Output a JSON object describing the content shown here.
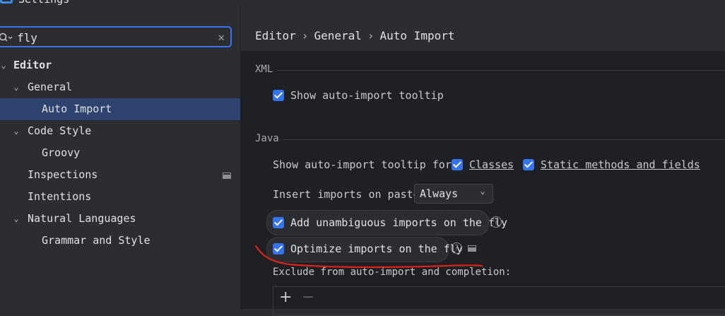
{
  "window": {
    "title": "Settings"
  },
  "search": {
    "value": "fly",
    "placeholder": ""
  },
  "tree": {
    "editor": "Editor",
    "general": "General",
    "auto_import": "Auto Import",
    "code_style": "Code Style",
    "groovy": "Groovy",
    "inspections": "Inspections",
    "intentions": "Intentions",
    "natural_languages": "Natural Languages",
    "grammar_and_style": "Grammar and Style"
  },
  "breadcrumb": [
    "Editor",
    "General",
    "Auto Import"
  ],
  "breadcrumb_sep": "›",
  "xml": {
    "section": "XML",
    "show_tooltip": "Show auto-import tooltip",
    "show_tooltip_checked": true
  },
  "java": {
    "section": "Java",
    "tooltip_for_label": "Show auto-import tooltip for:",
    "classes": "Classes",
    "static_methods": "Static methods and fields",
    "insert_on_paste_label": "Insert imports on paste:",
    "insert_on_paste_value": "Always",
    "add_unambiguous": "Add unambiguous imports on the fly",
    "optimize_imports": "Optimize imports on the fly",
    "exclude_label": "Exclude from auto-import and completion:"
  },
  "icons": {
    "search": "search-icon",
    "clear": "close-icon",
    "chevron": "chevron-down-icon",
    "help": "help-icon",
    "modified": "modified-indicator-icon",
    "add": "plus-icon",
    "remove": "minus-icon"
  },
  "colors": {
    "accent": "#3574f0",
    "selected_row": "#2e436e",
    "annotation": "#e0201b"
  }
}
